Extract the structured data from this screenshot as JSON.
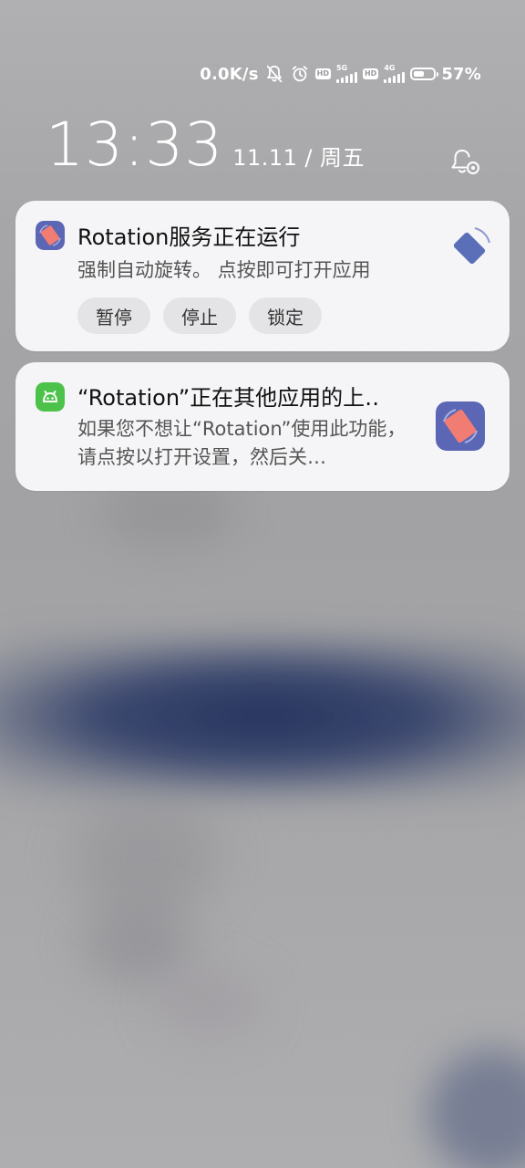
{
  "status_bar": {
    "net_speed": "0.0K/s",
    "battery_percent": 57,
    "battery_label": "57%",
    "hd_label": "HD",
    "signal_1_label": "5G",
    "signal_2_label": "4G",
    "icons": [
      "notifications-off-icon",
      "alarm-icon",
      "hd-volte-icon",
      "signal-5g-icon",
      "hd-volte-icon",
      "signal-4g-icon",
      "battery-icon"
    ]
  },
  "lockscreen": {
    "time": "13:33",
    "date": "11.11",
    "separator": "/",
    "weekday": "周五"
  },
  "notifications": [
    {
      "app_icon": "rotation-app-icon",
      "title": "Rotation服务正在运行",
      "text": "强制自动旋转。 点按即可打开应用",
      "large_icon": "rotation-diamond-icon",
      "actions": [
        "暂停",
        "停止",
        "锁定"
      ]
    },
    {
      "app_icon": "android-system-icon",
      "title": "“Rotation”正在其他应用的上‥",
      "text": "如果您不想让“Rotation”使用此功能，请点按以打开设置，然后关…",
      "large_icon": "rotation-app-icon"
    }
  ],
  "colors": {
    "card_bg": "#f5f5f7",
    "button_bg": "#e4e4e6",
    "rotation_purple": "#5b66b5",
    "rotation_salmon": "#f07c73",
    "android_green": "#4cc24a"
  }
}
